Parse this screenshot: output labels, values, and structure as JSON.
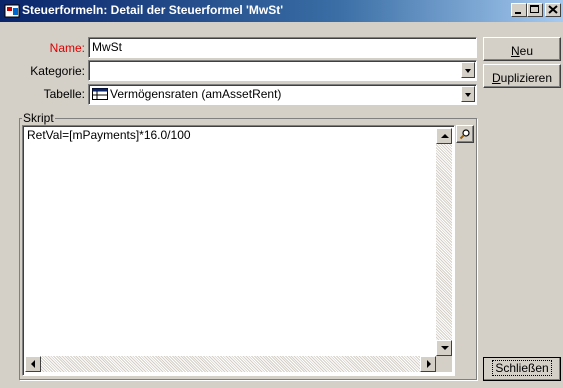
{
  "window": {
    "title": "Steuerformeln: Detail der Steuerformel 'MwSt'"
  },
  "fields": {
    "name": {
      "label": "Name:",
      "value": "MwSt"
    },
    "kategorie": {
      "label": "Kategorie:",
      "value": ""
    },
    "tabelle": {
      "label": "Tabelle:",
      "value": "Vermögensraten (amAssetRent)"
    }
  },
  "script": {
    "legend": "Skript",
    "content": "RetVal=[mPayments]*16.0/100"
  },
  "buttons": {
    "neu": {
      "first": "N",
      "rest": "eu"
    },
    "duplizieren": {
      "first": "D",
      "rest": "uplizieren"
    },
    "schliessen": {
      "label": "Schließen"
    }
  },
  "colors": {
    "title_start": "#0a246a",
    "title_end": "#a6caf0",
    "required_label": "#e00000",
    "face": "#d4d0c8"
  },
  "icons": [
    "app-icon",
    "minimize-icon",
    "maximize-icon",
    "close-icon",
    "table-icon",
    "search-icon"
  ]
}
